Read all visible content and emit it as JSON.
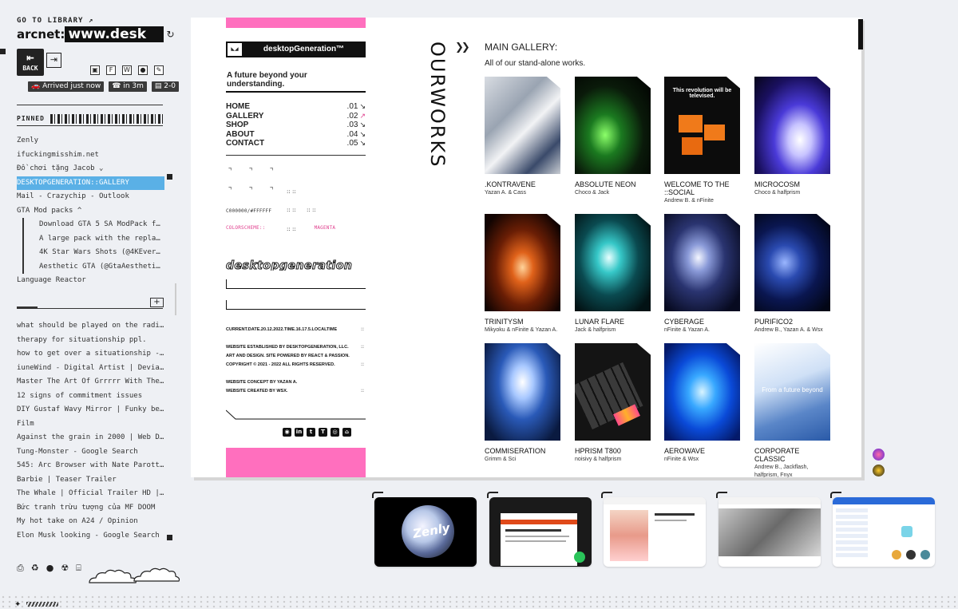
{
  "sidebar": {
    "go_to_library": "GO TO LIBRARY ↗",
    "url_prefix": "arcnet:",
    "url_value": "www.desk",
    "back_label": "BACK",
    "status": [
      "Arrived just now",
      "in 3m",
      "2-0"
    ],
    "pinned_label": "PINNED",
    "pinned_items": [
      "Zenly",
      "ifuckingmisshim.net",
      "Đồ chơi tặng Jacob ⌄",
      "DESKTOPGENERATION::GALLERY",
      "Mail - Crazychip - Outlook",
      "GTA Mod packs ^",
      "Download GTA 5 SA ModPack for GTA...",
      "A large pack with the replacement of...",
      "4K Star Wars Shots (@4KEverything...",
      "Aesthetic GTA (@GtaAesthetic) / Twi...",
      "Language Reactor"
    ],
    "tab_items": [
      "what should be played on the radio — eur...",
      "therapy for situationship ppl.",
      "how to get over a situationship - Google ...",
      "iuneWind - Digital Artist | DeviantArt",
      "Master The Art Of Grrrrr With These 10 T...",
      "12 signs of commitment issues",
      "DIY Gustaf Wavy Mirror | Funky bedroom...",
      "Film",
      "Against the grain in 2000 | Web Design ...",
      "Tung-Monster - Google Search",
      "545: Arc Browser with Nate Parott - Sho...",
      "Barbie | Teaser Trailer",
      "The Whale | Official Trailer HD | A24",
      "Bức tranh trừu tượng của MF DOOM",
      "My hot take on A24 / Opinion",
      "Elon Musk looking - Google Search"
    ]
  },
  "site": {
    "brand": "desktopGeneration™",
    "tagline": "A future beyond your understanding.",
    "menu": [
      {
        "label": "HOME",
        "num": ".01"
      },
      {
        "label": "GALLERY",
        "num": ".02"
      },
      {
        "label": "SHOP",
        "num": ".03"
      },
      {
        "label": "ABOUT",
        "num": ".04"
      },
      {
        "label": "CONTACT",
        "num": ".05"
      }
    ],
    "colors_text": "C000000/#FFFFFF",
    "colorscheme_text": "COLORSCHEME::",
    "colorscheme_value": "MAGENTA",
    "wordmark": "desktopgeneration",
    "current_date": "CURRENT.DATE.20.12.2022.TIME.16.17.5.LOCALTIME",
    "established_1": "WEBSITE ESTABLISHED BY DESKTOPGENERATION, LLC.",
    "established_2": "ART AND DESIGN. SITE POWERED BY REACT & PASSION.",
    "copyright": "COPYRIGHT © 2021 - 2022 ALL RIGHTS RESERVED.",
    "concept": "WEBSITE CONCEPT BY YAZAN A.",
    "created": "WEBSITE CREATED BY WSX.",
    "vertical_title": "OURWORKS",
    "gallery_title": "MAIN GALLERY:",
    "gallery_sub": "All of our stand-alone works.",
    "works": [
      {
        "title": ".KONTRAVENE",
        "author": "Yazan A. & Cass"
      },
      {
        "title": "ABSOLUTE NEON",
        "author": "Choco & Jack"
      },
      {
        "title": "WELCOME TO THE ::SOCIAL",
        "author": "Andrew B. & nFinite"
      },
      {
        "title": "MICROCOSM",
        "author": "Choco & halfprism"
      },
      {
        "title": "TRINITYSM",
        "author": "Mikyoku & nFinite & Yazan A."
      },
      {
        "title": "LUNAR FLARE",
        "author": "Jack & halfprism"
      },
      {
        "title": "CYBERAGE",
        "author": "nFinite & Yazan A."
      },
      {
        "title": "PURIFICO2",
        "author": "Andrew B., Yazan A. & Wsx"
      },
      {
        "title": "COMMISERATION",
        "author": "Grimm & Sci"
      },
      {
        "title": "HPRISM T800",
        "author": "noisivy & halfprism"
      },
      {
        "title": "AEROWAVE",
        "author": "nFinite & Wsx"
      },
      {
        "title": "CORPORATE CLASSIC",
        "author": "Andrew B., Jackflash, halfprism, Fnyx"
      }
    ],
    "social_thumb_text": "This revolution will be televised.",
    "corporate_thumb_text": "From a future beyond"
  },
  "tabs_preview": {
    "zenly_label": "Zenly"
  }
}
